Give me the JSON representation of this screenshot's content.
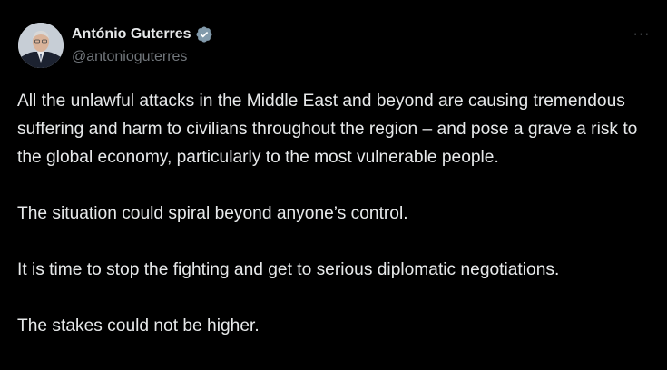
{
  "author": {
    "display_name": "António Guterres",
    "handle": "@antonioguterres",
    "verified": true,
    "verified_color": "#71767b"
  },
  "actions": {
    "more_label": "···"
  },
  "post": {
    "paragraphs": [
      "All the unlawful attacks in the Middle East and beyond are causing tremendous suffering and harm to civilians throughout the region – and pose a grave a risk to the global economy, particularly to the most vulnerable people.",
      "The situation could spiral beyond anyone’s control.",
      "It is time to stop the fighting and get to serious diplomatic negotiations.",
      "The stakes could not be higher."
    ]
  },
  "theme": {
    "background": "#000000",
    "text": "#e7e9ea",
    "secondary": "#71767b"
  }
}
